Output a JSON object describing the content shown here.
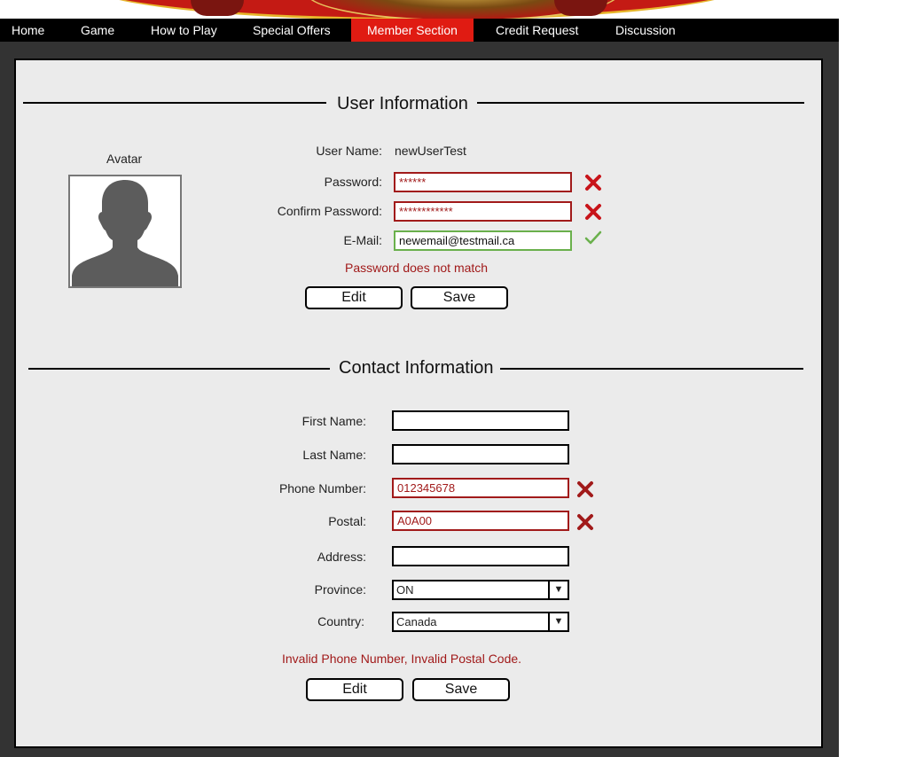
{
  "nav": {
    "items": [
      {
        "label": "Home"
      },
      {
        "label": "Game"
      },
      {
        "label": "How to Play"
      },
      {
        "label": "Special Offers"
      },
      {
        "label": "Member Section"
      },
      {
        "label": "Credit Request"
      },
      {
        "label": "Discussion"
      }
    ],
    "active_index": 4
  },
  "user_info": {
    "title": "User Information",
    "avatar_label": "Avatar",
    "username_label": "User Name:",
    "username_value": "newUserTest",
    "password_label": "Password:",
    "password_value": "******",
    "confirm_label": "Confirm Password:",
    "confirm_value": "************",
    "email_label": "E-Mail:",
    "email_value": "newemail@testmail.ca",
    "error": "Password does not match",
    "edit_label": "Edit",
    "save_label": "Save"
  },
  "contact_info": {
    "title": "Contact Information",
    "first_name_label": "First Name:",
    "first_name_value": "",
    "last_name_label": "Last Name:",
    "last_name_value": "",
    "phone_label": "Phone Number:",
    "phone_value": "012345678",
    "postal_label": "Postal:",
    "postal_value": "A0A00",
    "address_label": "Address:",
    "address_value": "",
    "province_label": "Province:",
    "province_value": "ON",
    "country_label": "Country:",
    "country_value": "Canada",
    "error": "Invalid Phone Number, Invalid Postal Code.",
    "edit_label": "Edit",
    "save_label": "Save"
  },
  "colors": {
    "nav_bg": "#000000",
    "nav_active": "#e01b12",
    "error": "#a11a1a",
    "valid": "#6ab04c",
    "panel_bg": "#ebebeb",
    "frame_bg": "#333333"
  },
  "icons": {
    "invalid": "close-x-icon",
    "valid": "checkmark-icon",
    "avatar": "person-silhouette-icon",
    "dropdown": "triangle-down-icon"
  }
}
